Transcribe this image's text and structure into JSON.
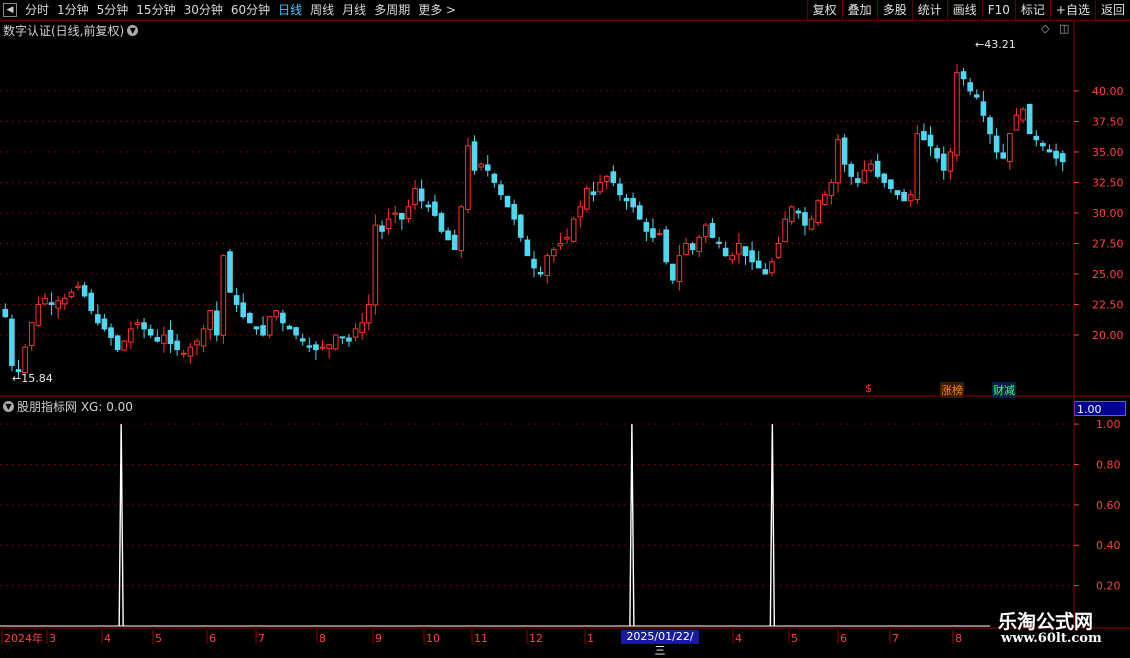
{
  "toolbar": {
    "back_icon": "back-arrow-icon",
    "periods": [
      "分时",
      "1分钟",
      "5分钟",
      "15分钟",
      "30分钟",
      "60分钟",
      "日线",
      "周线",
      "月线",
      "多周期",
      "更多 >"
    ],
    "active_period": "日线",
    "right_buttons": [
      "复权",
      "叠加",
      "多股",
      "统计",
      "画线",
      "F10",
      "标记",
      "+自选",
      "返回"
    ]
  },
  "main_panel": {
    "title": "数字认证(日线,前复权)",
    "high_label": "43.21",
    "low_label": "15.84",
    "y_ticks": [
      "40.00",
      "37.50",
      "35.00",
      "32.50",
      "30.00",
      "27.50",
      "25.00",
      "22.50",
      "20.00"
    ],
    "badges": [
      "$",
      "涨榜",
      "财减"
    ],
    "colors": {
      "up": "#ff3030",
      "down": "#4fd8f0",
      "axis": "#ff4040",
      "grid": "#8b0000"
    }
  },
  "indicator_panel": {
    "title": "股朋指标网 XG: 0.00",
    "current_value": "1.00",
    "y_ticks": [
      "1.00",
      "0.80",
      "0.60",
      "0.40",
      "0.20"
    ]
  },
  "x_axis": {
    "labels": [
      "2024年",
      "3",
      "4",
      "5",
      "6",
      "7",
      "8",
      "9",
      "10",
      "11",
      "12",
      "1",
      "4",
      "5",
      "6",
      "7",
      "8"
    ],
    "cursor_date": "2025/01/22/三"
  },
  "watermark": {
    "line1": "乐淘公式网",
    "line2": "www.60lt.com"
  },
  "chart_data": [
    {
      "type": "candlestick",
      "title": "数字认证(日线,前复权)",
      "ylim": [
        15.0,
        44.5
      ],
      "ylabel": "",
      "y_ticks": [
        20.0,
        22.5,
        25.0,
        27.5,
        30.0,
        32.5,
        35.0,
        37.5,
        40.0
      ],
      "annotations": [
        {
          "label": "43.21",
          "type": "high"
        },
        {
          "label": "15.84",
          "type": "low"
        }
      ],
      "close_path": [
        21.5,
        17.5,
        17.0,
        19.0,
        21.0,
        22.5,
        23.0,
        22.5,
        22.8,
        23.0,
        23.5,
        24.0,
        23.2,
        22.0,
        21.0,
        20.5,
        19.8,
        18.8,
        19.5,
        20.5,
        21.0,
        20.5,
        20.0,
        19.5,
        20.0,
        19.3,
        18.8,
        18.5,
        19.0,
        19.5,
        20.5,
        22.0,
        20.0,
        26.5,
        23.5,
        22.5,
        21.5,
        21.0,
        20.5,
        20.0,
        21.5,
        22.0,
        21.0,
        20.5,
        20.0,
        19.5,
        19.0,
        18.8,
        19.0,
        19.2,
        20.0,
        19.8,
        19.5,
        20.5,
        21.0,
        22.5,
        29.0,
        28.5,
        29.5,
        30.0,
        29.5,
        30.5,
        32.0,
        31.0,
        30.5,
        29.8,
        28.5,
        27.8,
        27.0,
        30.5,
        35.5,
        33.5,
        34.0,
        33.5,
        32.5,
        31.5,
        30.5,
        29.5,
        28.0,
        26.5,
        25.5,
        25.0,
        26.5,
        27.0,
        27.5,
        28.0,
        29.5,
        30.5,
        32.0,
        31.5,
        32.5,
        33.0,
        32.5,
        31.5,
        31.0,
        30.5,
        29.5,
        28.5,
        28.0,
        28.3,
        26.0,
        24.5,
        26.5,
        27.5,
        27.0,
        28.0,
        29.0,
        28.0,
        27.5,
        26.5,
        26.5,
        27.5,
        26.5,
        26.0,
        25.5,
        25.0,
        26.0,
        27.5,
        29.5,
        30.5,
        30.0,
        29.0,
        29.5,
        31.0,
        31.5,
        32.5,
        36.0,
        34.0,
        33.0,
        32.5,
        33.5,
        34.0,
        33.0,
        32.5,
        32.0,
        31.5,
        31.0,
        31.5,
        36.5,
        36.0,
        35.5,
        34.5,
        33.5,
        35.0,
        41.5,
        41.0,
        40.0,
        39.5,
        38.0,
        36.5,
        35.0,
        34.5,
        36.5,
        38.0,
        38.5,
        36.5,
        36.0,
        35.5,
        35.0,
        34.5,
        34.2
      ]
    },
    {
      "type": "line",
      "title": "股朋指标网 XG",
      "ylim": [
        0,
        1.05
      ],
      "y_ticks": [
        0.2,
        0.4,
        0.6,
        0.8,
        1.0
      ],
      "signals": [
        {
          "index": 28,
          "value": 1.0
        },
        {
          "index": 148,
          "value": 1.0
        },
        {
          "index": 181,
          "value": 1.0
        }
      ],
      "baseline": 0.0,
      "series_length": 250
    }
  ]
}
